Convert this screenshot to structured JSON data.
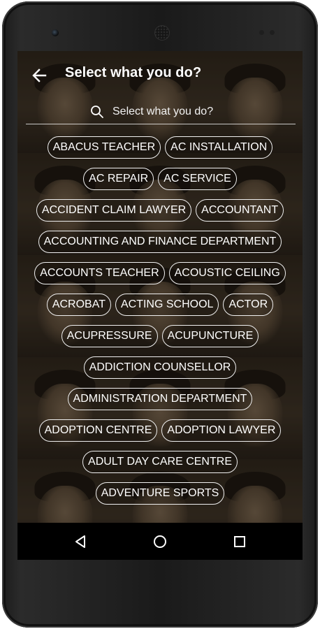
{
  "header": {
    "title": "Select what you do?",
    "back_icon": "arrow-left-icon"
  },
  "search": {
    "placeholder": "Select what you do?",
    "value": "",
    "icon": "search-icon"
  },
  "chips": [
    [
      "ABACUS TEACHER",
      "AC INSTALLATION"
    ],
    [
      "AC REPAIR",
      "AC SERVICE"
    ],
    [
      "ACCIDENT CLAIM LAWYER",
      "ACCOUNTANT"
    ],
    [
      "ACCOUNTING AND FINANCE DEPARTMENT"
    ],
    [
      "ACCOUNTS TEACHER",
      "ACOUSTIC CEILING"
    ],
    [
      "ACROBAT",
      "ACTING SCHOOL",
      "ACTOR"
    ],
    [
      "ACUPRESSURE",
      "ACUPUNCTURE"
    ],
    [
      "ADDICTION COUNSELLOR"
    ],
    [
      "ADMINISTRATION DEPARTMENT"
    ],
    [
      "ADOPTION CENTRE",
      "ADOPTION LAWYER"
    ],
    [
      "ADULT DAY CARE CENTRE"
    ],
    [
      "ADVENTURE SPORTS"
    ]
  ],
  "navbar": {
    "back_icon": "triangle-back-icon",
    "home_icon": "circle-home-icon",
    "recents_icon": "square-recents-icon"
  },
  "colors": {
    "text": "#ffffff",
    "navbar": "#000000",
    "screen_background": "#221c15"
  }
}
